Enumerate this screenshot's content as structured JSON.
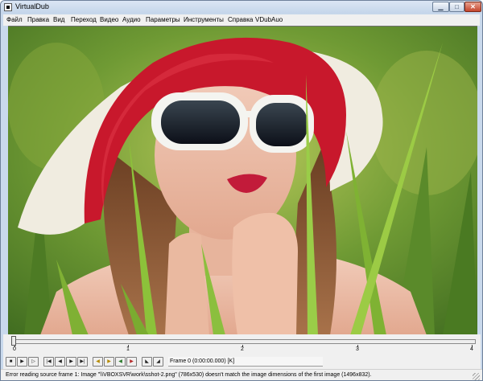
{
  "window": {
    "title": "VirtualDub"
  },
  "window_controls": {
    "minimize": "▁",
    "maximize": "□",
    "close": "✕"
  },
  "menu": [
    "Файл",
    "Правка",
    "Вид",
    "Переход",
    "Видео",
    "Аудио",
    "Параметры",
    "Инструменты",
    "Справка",
    "VDubAuo"
  ],
  "timeline": {
    "tick_labels": [
      "0",
      "1",
      "2",
      "3",
      "4"
    ],
    "current_position": 0
  },
  "toolbar": {
    "buttons": [
      "stop-icon",
      "play-input-icon",
      "play-output-icon",
      "go-start-icon",
      "step-back-icon",
      "step-forward-icon",
      "go-end-icon",
      "key-prev-icon",
      "key-next-icon",
      "scene-prev-icon",
      "scene-next-icon",
      "mark-in-icon",
      "mark-out-icon"
    ],
    "frame_info": "Frame 0 (0:00:00.000) [K]"
  },
  "status": {
    "message": "Error reading source frame 1: Image \"\\\\VBOXSVR\\work\\sshot-2.png\" (786x530) doesn't match the image dimensions of the first image (1496x832)."
  },
  "colors": {
    "hat_red": "#c8182c",
    "grass_green": "#5f8f2e",
    "glasses_white": "#f4f4f0"
  }
}
